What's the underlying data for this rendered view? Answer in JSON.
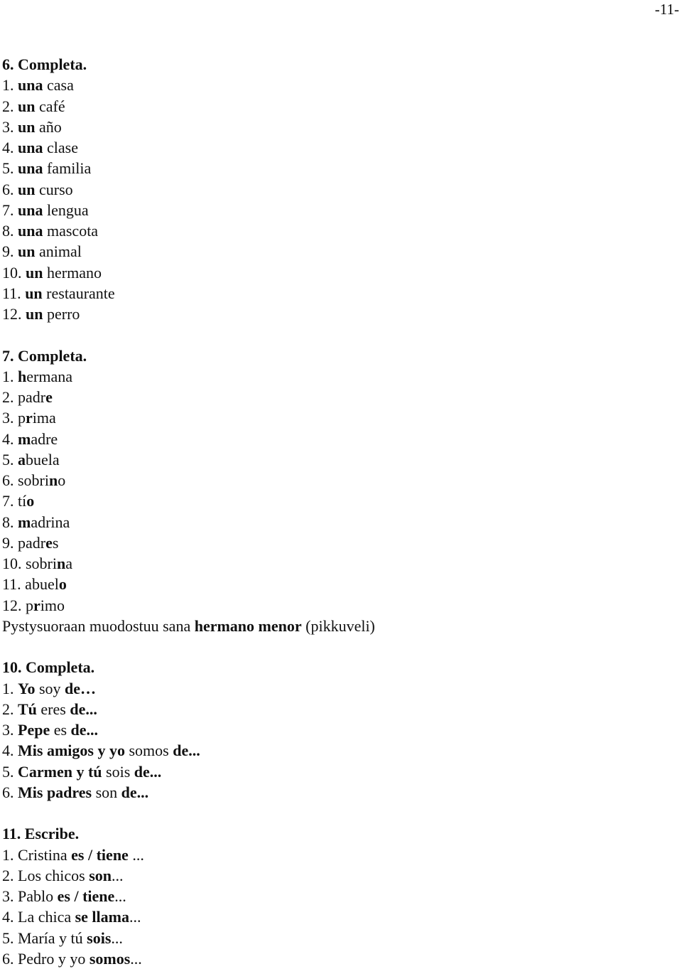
{
  "page_number": "-11-",
  "sections": [
    {
      "heading": "6. Completa.",
      "lines": [
        [
          {
            "t": "1. ",
            "b": false
          },
          {
            "t": "una",
            "b": true
          },
          {
            "t": " casa",
            "b": false
          }
        ],
        [
          {
            "t": "2. ",
            "b": false
          },
          {
            "t": "un",
            "b": true
          },
          {
            "t": " café",
            "b": false
          }
        ],
        [
          {
            "t": "3. ",
            "b": false
          },
          {
            "t": "un",
            "b": true
          },
          {
            "t": " año",
            "b": false
          }
        ],
        [
          {
            "t": "4. ",
            "b": false
          },
          {
            "t": "una",
            "b": true
          },
          {
            "t": " clase",
            "b": false
          }
        ],
        [
          {
            "t": "5. ",
            "b": false
          },
          {
            "t": "una",
            "b": true
          },
          {
            "t": " familia",
            "b": false
          }
        ],
        [
          {
            "t": "6. ",
            "b": false
          },
          {
            "t": "un",
            "b": true
          },
          {
            "t": " curso",
            "b": false
          }
        ],
        [
          {
            "t": "7. ",
            "b": false
          },
          {
            "t": "una",
            "b": true
          },
          {
            "t": " lengua",
            "b": false
          }
        ],
        [
          {
            "t": "8. ",
            "b": false
          },
          {
            "t": "una",
            "b": true
          },
          {
            "t": " mascota",
            "b": false
          }
        ],
        [
          {
            "t": "9. ",
            "b": false
          },
          {
            "t": "un",
            "b": true
          },
          {
            "t": " animal",
            "b": false
          }
        ],
        [
          {
            "t": "10. ",
            "b": false
          },
          {
            "t": "un",
            "b": true
          },
          {
            "t": " hermano",
            "b": false
          }
        ],
        [
          {
            "t": "11. ",
            "b": false
          },
          {
            "t": "un",
            "b": true
          },
          {
            "t": " restaurante",
            "b": false
          }
        ],
        [
          {
            "t": "12. ",
            "b": false
          },
          {
            "t": "un",
            "b": true
          },
          {
            "t": " perro",
            "b": false
          }
        ]
      ]
    },
    {
      "heading": "7. Completa.",
      "lines": [
        [
          {
            "t": "1. ",
            "b": false
          },
          {
            "t": "h",
            "b": true
          },
          {
            "t": "ermana",
            "b": false
          }
        ],
        [
          {
            "t": "2. padr",
            "b": false
          },
          {
            "t": "e",
            "b": true
          }
        ],
        [
          {
            "t": "3. p",
            "b": false
          },
          {
            "t": "r",
            "b": true
          },
          {
            "t": "ima",
            "b": false
          }
        ],
        [
          {
            "t": "4. ",
            "b": false
          },
          {
            "t": "m",
            "b": true
          },
          {
            "t": "adre",
            "b": false
          }
        ],
        [
          {
            "t": "5. ",
            "b": false
          },
          {
            "t": "a",
            "b": true
          },
          {
            "t": "buela",
            "b": false
          }
        ],
        [
          {
            "t": "6. sobri",
            "b": false
          },
          {
            "t": "n",
            "b": true
          },
          {
            "t": "o",
            "b": false
          }
        ],
        [
          {
            "t": "7. tí",
            "b": false
          },
          {
            "t": "o",
            "b": true
          }
        ],
        [
          {
            "t": "8. ",
            "b": false
          },
          {
            "t": "m",
            "b": true
          },
          {
            "t": "adrina",
            "b": false
          }
        ],
        [
          {
            "t": "9. padr",
            "b": false
          },
          {
            "t": "e",
            "b": true
          },
          {
            "t": "s",
            "b": false
          }
        ],
        [
          {
            "t": "10. sobri",
            "b": false
          },
          {
            "t": "n",
            "b": true
          },
          {
            "t": "a",
            "b": false
          }
        ],
        [
          {
            "t": "11. abuel",
            "b": false
          },
          {
            "t": "o",
            "b": true
          }
        ],
        [
          {
            "t": "12. p",
            "b": false
          },
          {
            "t": "r",
            "b": true
          },
          {
            "t": "imo",
            "b": false
          }
        ],
        [
          {
            "t": "Pystysuoraan muodostuu sana ",
            "b": false
          },
          {
            "t": "hermano menor",
            "b": true
          },
          {
            "t": " (pikkuveli)",
            "b": false
          }
        ]
      ]
    },
    {
      "heading": "10. Completa.",
      "lines": [
        [
          {
            "t": "1. ",
            "b": false
          },
          {
            "t": "Yo",
            "b": true
          },
          {
            "t": " soy ",
            "b": false
          },
          {
            "t": "de…",
            "b": true
          }
        ],
        [
          {
            "t": "2. ",
            "b": false
          },
          {
            "t": "Tú",
            "b": true
          },
          {
            "t": " eres ",
            "b": false
          },
          {
            "t": "de...",
            "b": true
          }
        ],
        [
          {
            "t": "3. ",
            "b": false
          },
          {
            "t": "Pepe",
            "b": true
          },
          {
            "t": " es ",
            "b": false
          },
          {
            "t": "de...",
            "b": true
          }
        ],
        [
          {
            "t": "4. ",
            "b": false
          },
          {
            "t": "Mis amigos y yo",
            "b": true
          },
          {
            "t": " somos ",
            "b": false
          },
          {
            "t": "de...",
            "b": true
          }
        ],
        [
          {
            "t": "5. ",
            "b": false
          },
          {
            "t": "Carmen y tú",
            "b": true
          },
          {
            "t": " sois ",
            "b": false
          },
          {
            "t": "de...",
            "b": true
          }
        ],
        [
          {
            "t": "6. ",
            "b": false
          },
          {
            "t": "Mis padres",
            "b": true
          },
          {
            "t": " son ",
            "b": false
          },
          {
            "t": "de...",
            "b": true
          }
        ]
      ]
    },
    {
      "heading": "11. Escribe.",
      "lines": [
        [
          {
            "t": "1. Cristina ",
            "b": false
          },
          {
            "t": "es / tiene",
            "b": true
          },
          {
            "t": " ...",
            "b": false
          }
        ],
        [
          {
            "t": "2. Los chicos ",
            "b": false
          },
          {
            "t": "son",
            "b": true
          },
          {
            "t": "...",
            "b": false
          }
        ],
        [
          {
            "t": "3. Pablo ",
            "b": false
          },
          {
            "t": "es / tiene",
            "b": true
          },
          {
            "t": "...",
            "b": false
          }
        ],
        [
          {
            "t": "4. La chica ",
            "b": false
          },
          {
            "t": "se llama",
            "b": true
          },
          {
            "t": "...",
            "b": false
          }
        ],
        [
          {
            "t": "5. María y tú ",
            "b": false
          },
          {
            "t": "sois",
            "b": true
          },
          {
            "t": "...",
            "b": false
          }
        ],
        [
          {
            "t": "6. Pedro y yo ",
            "b": false
          },
          {
            "t": "somos",
            "b": true
          },
          {
            "t": "...",
            "b": false
          }
        ]
      ]
    }
  ]
}
